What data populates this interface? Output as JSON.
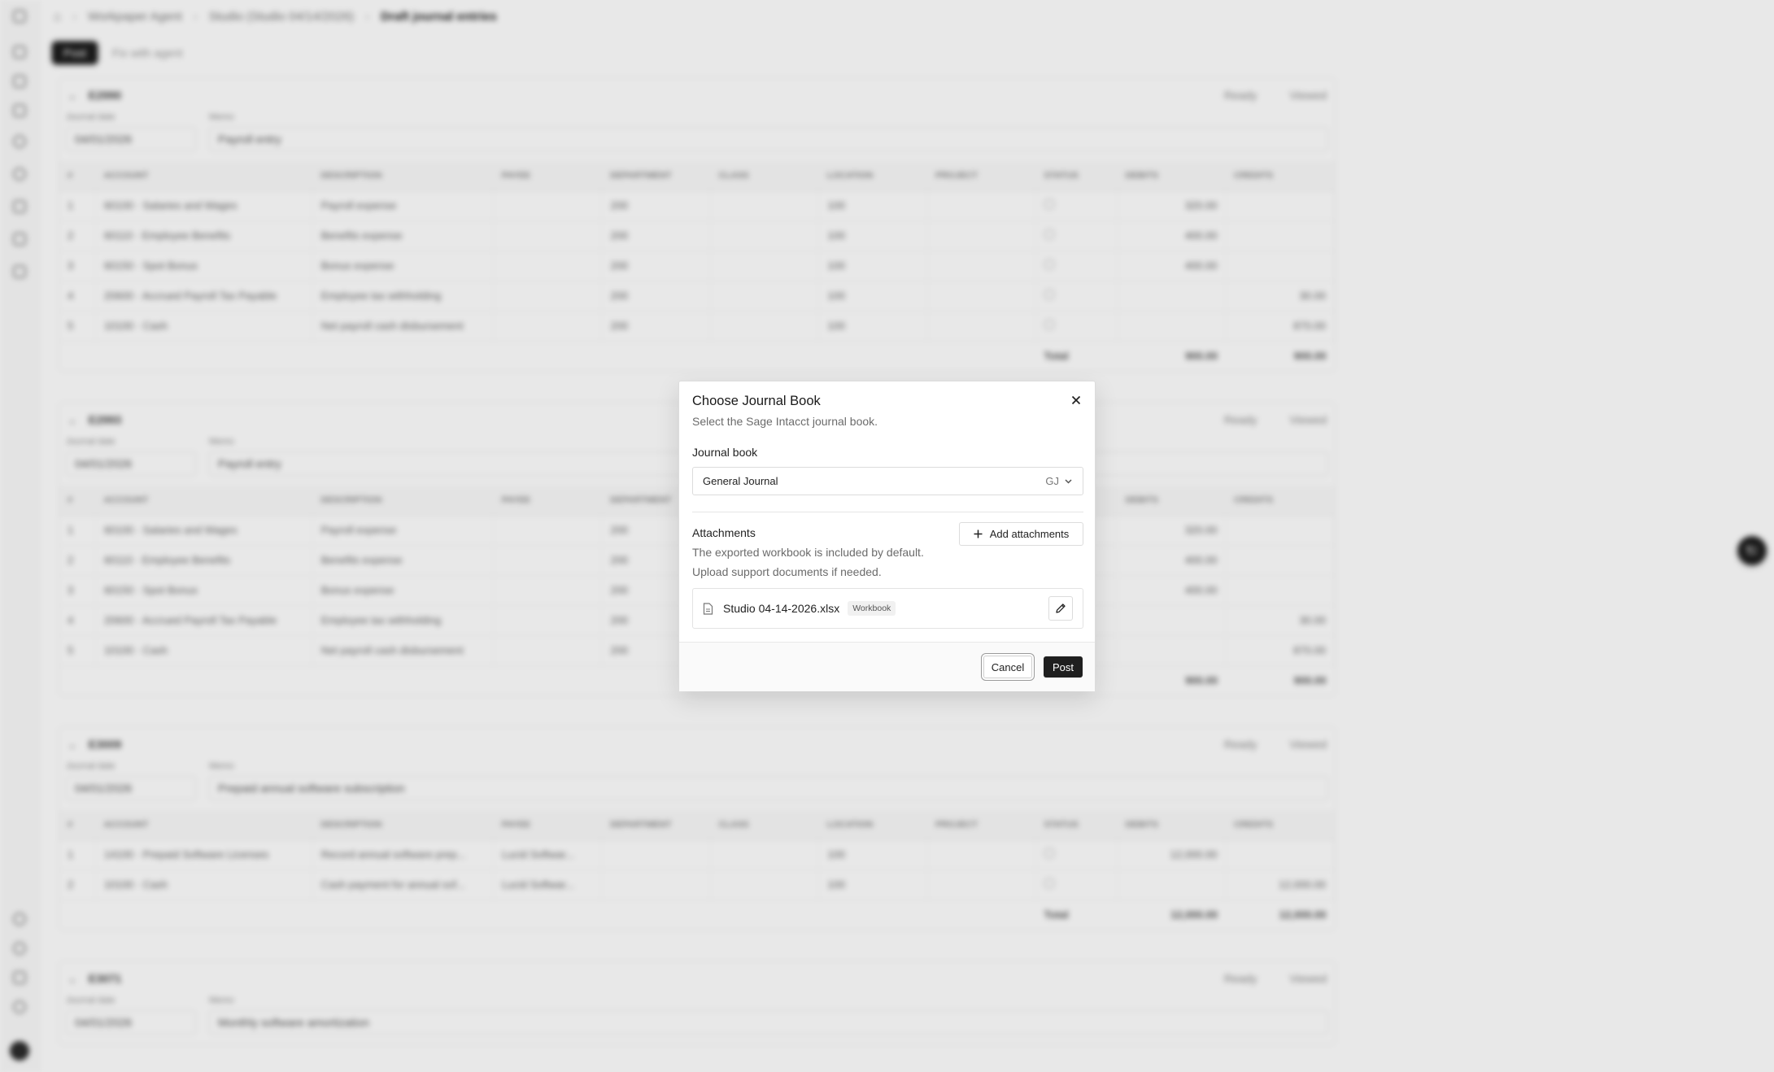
{
  "background": {
    "breadcrumb": [
      "Workpaper Agent",
      "Studio (Studio 04/14/2026)",
      "Draft journal entries"
    ],
    "toolbar": {
      "post_label": "Post",
      "fix_label": "Fix with agent"
    },
    "table_headers": [
      "#",
      "ACCOUNT",
      "DESCRIPTION",
      "PAYEE",
      "DEPARTMENT",
      "CLASS",
      "LOCATION",
      "PROJECT",
      "STATUS",
      "DEBITS",
      "CREDITS"
    ],
    "entries": [
      {
        "id": "E2990",
        "status_ready": "Ready",
        "status_viewed": "Viewed",
        "journal_date": "04/01/2026",
        "memo": "Payroll entry",
        "rows": [
          {
            "n": "1",
            "account": "60100 · Salaries and Wages",
            "desc": "Payroll expense",
            "payee": "",
            "dept": "200",
            "cls": "",
            "loc": "100",
            "proj": "",
            "debit": "320.00",
            "credit": ""
          },
          {
            "n": "2",
            "account": "60110 · Employee Benefits",
            "desc": "Benefits expense",
            "payee": "",
            "dept": "200",
            "cls": "",
            "loc": "100",
            "proj": "",
            "debit": "400.00",
            "credit": ""
          },
          {
            "n": "3",
            "account": "60150 · Spot Bonus",
            "desc": "Bonus expense",
            "payee": "",
            "dept": "200",
            "cls": "",
            "loc": "100",
            "proj": "",
            "debit": "400.00",
            "credit": ""
          },
          {
            "n": "4",
            "account": "20600 · Accrued Payroll Tax Payable",
            "desc": "Employee tax withholding",
            "payee": "",
            "dept": "200",
            "cls": "",
            "loc": "100",
            "proj": "",
            "debit": "",
            "credit": "30.00"
          },
          {
            "n": "5",
            "account": "10100 · Cash",
            "desc": "Net payroll cash disbursement",
            "payee": "",
            "dept": "200",
            "cls": "",
            "loc": "100",
            "proj": "",
            "debit": "",
            "credit": "870.00"
          }
        ],
        "total_label": "Total",
        "total_debit": "900.00",
        "total_credit": "900.00"
      },
      {
        "id": "E2993",
        "status_ready": "Ready",
        "status_viewed": "Viewed",
        "journal_date": "04/01/2026",
        "memo": "Payroll entry",
        "rows": [
          {
            "n": "1",
            "account": "60100 · Salaries and Wages",
            "desc": "Payroll expense",
            "payee": "",
            "dept": "200",
            "cls": "",
            "loc": "100",
            "proj": "",
            "debit": "320.00",
            "credit": ""
          },
          {
            "n": "2",
            "account": "60110 · Employee Benefits",
            "desc": "Benefits expense",
            "payee": "",
            "dept": "200",
            "cls": "",
            "loc": "100",
            "proj": "",
            "debit": "400.00",
            "credit": ""
          },
          {
            "n": "3",
            "account": "60150 · Spot Bonus",
            "desc": "Bonus expense",
            "payee": "",
            "dept": "200",
            "cls": "",
            "loc": "100",
            "proj": "",
            "debit": "400.00",
            "credit": ""
          },
          {
            "n": "4",
            "account": "20600 · Accrued Payroll Tax Payable",
            "desc": "Employee tax withholding",
            "payee": "",
            "dept": "200",
            "cls": "",
            "loc": "100",
            "proj": "",
            "debit": "",
            "credit": "30.00"
          },
          {
            "n": "5",
            "account": "10100 · Cash",
            "desc": "Net payroll cash disbursement",
            "payee": "",
            "dept": "200",
            "cls": "",
            "loc": "100",
            "proj": "",
            "debit": "",
            "credit": "870.00"
          }
        ],
        "total_label": "Total",
        "total_debit": "900.00",
        "total_credit": "900.00"
      },
      {
        "id": "E3009",
        "status_ready": "Ready",
        "status_viewed": "Viewed",
        "journal_date": "04/01/2026",
        "memo": "Prepaid annual software subscription",
        "rows": [
          {
            "n": "1",
            "account": "14100 · Prepaid Software Licenses",
            "desc": "Record annual software prep...",
            "payee": "Lucid Softwar...",
            "dept": "",
            "cls": "",
            "loc": "100",
            "proj": "",
            "debit": "12,000.00",
            "credit": ""
          },
          {
            "n": "2",
            "account": "10100 · Cash",
            "desc": "Cash payment for annual sof...",
            "payee": "Lucid Softwar...",
            "dept": "",
            "cls": "",
            "loc": "100",
            "proj": "",
            "debit": "",
            "credit": "12,000.00"
          }
        ],
        "total_label": "Total",
        "total_debit": "12,000.00",
        "total_credit": "12,000.00"
      },
      {
        "id": "E3071",
        "status_ready": "Ready",
        "status_viewed": "Viewed",
        "journal_date": "04/01/2026",
        "memo": "Monthly software amortization",
        "rows": [],
        "total_label": "",
        "total_debit": "",
        "total_credit": ""
      }
    ],
    "field_labels": {
      "journal_date": "Journal date",
      "memo": "Memo"
    }
  },
  "modal": {
    "title": "Choose Journal Book",
    "subtitle": "Select the Sage Intacct journal book.",
    "journal_book_label": "Journal book",
    "journal_book_value": "General Journal",
    "journal_book_code": "GJ",
    "attachments_label": "Attachments",
    "add_attachments_label": "Add attachments",
    "attachments_desc_1": "The exported workbook is included by default.",
    "attachments_desc_2": "Upload support documents if needed.",
    "file_name": "Studio 04-14-2026.xlsx",
    "file_badge": "Workbook",
    "cancel_label": "Cancel",
    "post_label": "Post"
  }
}
